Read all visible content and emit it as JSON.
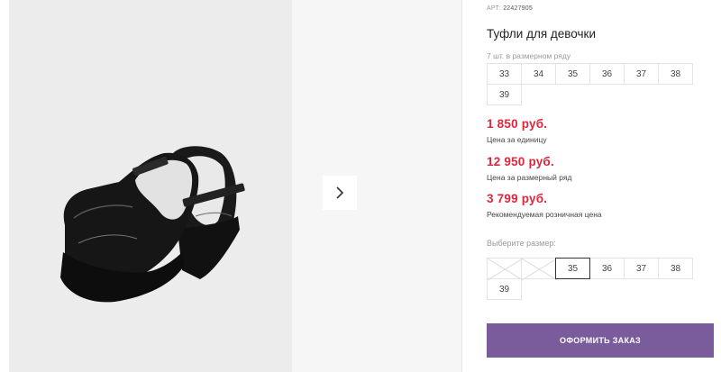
{
  "product": {
    "art_label": "АРТ:",
    "art_number": "22427905",
    "title": "Туфли для девочки",
    "row_note": "7 шт. в размерном ряду",
    "row_sizes": [
      "33",
      "34",
      "35",
      "36",
      "37",
      "38",
      "39"
    ]
  },
  "prices": {
    "unit_price": "1 850 руб.",
    "unit_label": "Цена за единицу",
    "row_price": "12 950 руб.",
    "row_label": "Цена за размерный ряд",
    "retail_price": "3 799 руб.",
    "retail_label": "Рекомендуемая розничная цена",
    "price_color": "#e0263b"
  },
  "size_select": {
    "label": "Выберите размер:",
    "options": [
      {
        "label": "",
        "state": "unavailable"
      },
      {
        "label": "",
        "state": "unavailable"
      },
      {
        "label": "35",
        "state": "selected"
      },
      {
        "label": "36",
        "state": "available"
      },
      {
        "label": "37",
        "state": "available"
      },
      {
        "label": "38",
        "state": "available"
      },
      {
        "label": "39",
        "state": "available"
      }
    ]
  },
  "actions": {
    "order_label": "ОФОРМИТЬ ЗАКАЗ",
    "accent_color": "#7a5c9c"
  },
  "gallery": {
    "next_icon": "chevron-right-icon",
    "image_subject": "black-shoes"
  }
}
